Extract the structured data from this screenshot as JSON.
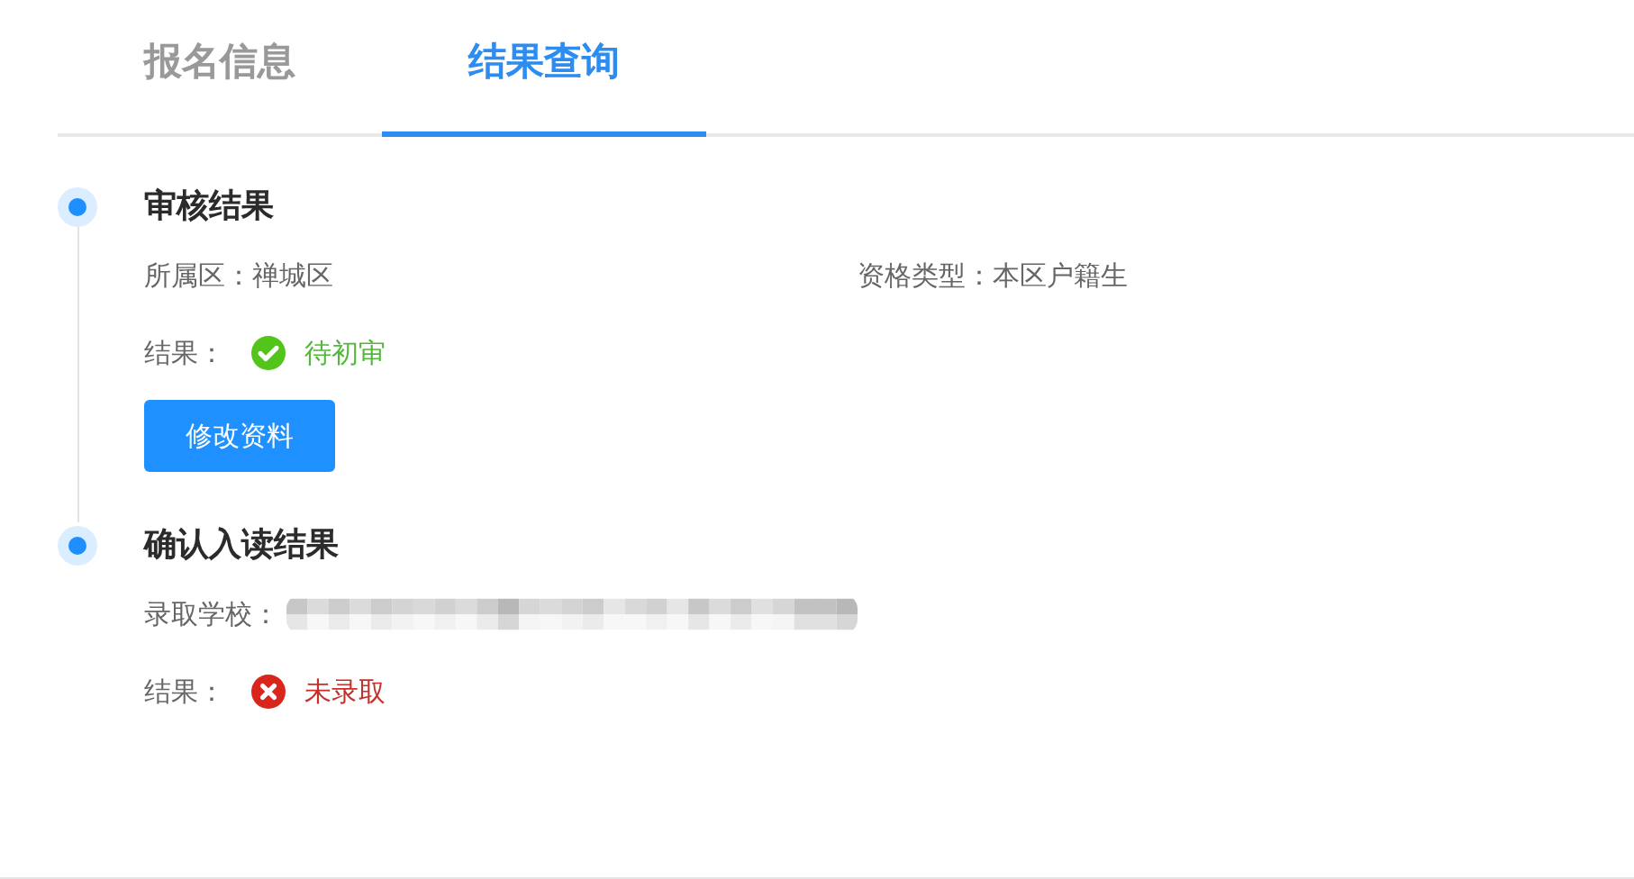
{
  "tabs": [
    {
      "label": "报名信息",
      "selected": false
    },
    {
      "label": "结果查询",
      "selected": true
    }
  ],
  "sections": [
    {
      "title": "审核结果",
      "fields": [
        {
          "kind": "text",
          "label": "所属区：",
          "value": "禅城区"
        },
        {
          "kind": "text",
          "label": "资格类型：",
          "value": "本区户籍生"
        }
      ],
      "result": {
        "label": "结果：",
        "kind": "success",
        "text": "待初审"
      },
      "button": "修改资料"
    },
    {
      "title": "确认入读结果",
      "fields": [
        {
          "kind": "redacted",
          "label": "录取学校："
        }
      ],
      "result": {
        "label": "结果：",
        "kind": "error",
        "text": "未录取"
      }
    }
  ]
}
